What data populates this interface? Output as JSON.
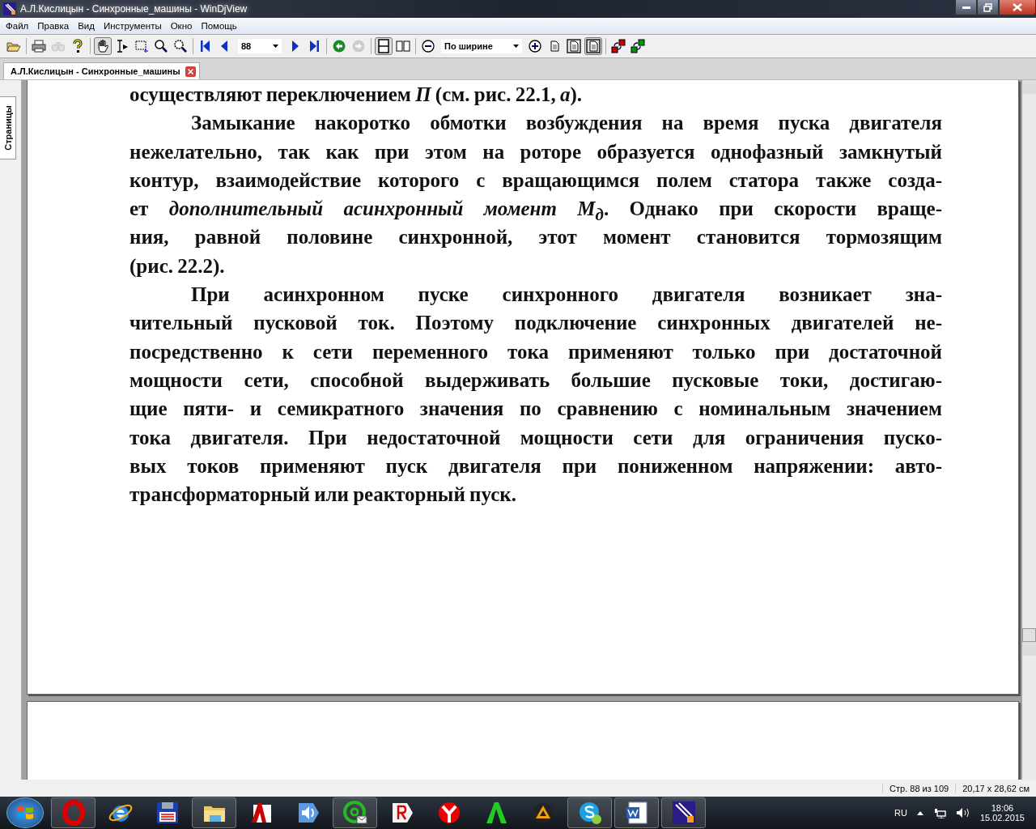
{
  "window": {
    "title": "А.Л.Кислицын - Синхронные_машины - WinDjView"
  },
  "menu": [
    "Файл",
    "Правка",
    "Вид",
    "Инструменты",
    "Окно",
    "Помощь"
  ],
  "toolbar": [
    {
      "kind": "open",
      "selected": false,
      "disabled": false
    },
    {
      "kind": "sep"
    },
    {
      "kind": "print",
      "selected": false,
      "disabled": false
    },
    {
      "kind": "find",
      "selected": false,
      "disabled": true
    },
    {
      "kind": "help",
      "selected": false,
      "disabled": false
    },
    {
      "kind": "sep"
    },
    {
      "kind": "hand",
      "selected": true,
      "disabled": false
    },
    {
      "kind": "text-select",
      "selected": false,
      "disabled": false
    },
    {
      "kind": "rect-select",
      "selected": false,
      "disabled": false
    },
    {
      "kind": "zoom",
      "selected": false,
      "disabled": false
    },
    {
      "kind": "zoom-rect",
      "selected": false,
      "disabled": false
    },
    {
      "kind": "sep"
    },
    {
      "kind": "first",
      "selected": false,
      "disabled": false
    },
    {
      "kind": "prev",
      "selected": false,
      "disabled": false
    },
    {
      "kind": "combo",
      "value": "88"
    },
    {
      "kind": "next",
      "selected": false,
      "disabled": false
    },
    {
      "kind": "last",
      "selected": false,
      "disabled": false
    },
    {
      "kind": "sep"
    },
    {
      "kind": "back",
      "selected": false,
      "disabled": false
    },
    {
      "kind": "forward",
      "selected": false,
      "disabled": true
    },
    {
      "kind": "sep"
    },
    {
      "kind": "single-page",
      "selected": true,
      "disabled": false
    },
    {
      "kind": "two-pages",
      "selected": false,
      "disabled": false
    },
    {
      "kind": "sep"
    },
    {
      "kind": "zoom-out",
      "selected": false,
      "disabled": false
    },
    {
      "kind": "combo",
      "value": "По ширине"
    },
    {
      "kind": "zoom-in",
      "selected": false,
      "disabled": false
    },
    {
      "kind": "page",
      "selected": false,
      "disabled": false
    },
    {
      "kind": "page-frame",
      "selected": false,
      "disabled": false
    },
    {
      "kind": "page-frame",
      "selected": true,
      "disabled": false
    },
    {
      "kind": "sep"
    },
    {
      "kind": "rotate-left",
      "selected": false,
      "disabled": false
    },
    {
      "kind": "rotate-right",
      "selected": false,
      "disabled": false
    }
  ],
  "tabs": [
    {
      "label": "А.Л.Кислицын - Синхронные_машины",
      "selected": true
    }
  ],
  "sidebar": {
    "tab": "Страницы"
  },
  "page": {
    "paragraphs": [
      {
        "indent": false,
        "lines": [
          "осуществляют переключением *П* (см. рис. 22.1, *а*)."
        ]
      },
      {
        "indent": true,
        "lines": [
          "Замыкание накоротко обмотки возбуждения на время пуска двигателя",
          "нежелательно, так как при этом на роторе образуется однофазный замкнутый",
          "контур, взаимодействие которого с вращающимся полем статора также созда-",
          "ет *дополнительный асинхронный момент M$_{д}$*. Однако при скорости враще-",
          "ния, равной половине синхронной, этот момент становится тормозящим",
          "(рис. 22.2)."
        ]
      },
      {
        "indent": true,
        "lines": [
          "При асинхронном пуске синхронного двигателя возникает зна-",
          "чительный пусковой ток. Поэтому подключение синхронных двигателей не-",
          "посредственно к сети переменного тока применяют только при достаточной",
          "мощности сети, способной выдерживать большие пусковые токи, достигаю-",
          "щие пяти- и семикратного значения по сравнению с номинальным значением",
          "тока двигателя. При недостаточной мощности сети для ограничения пуско-",
          "вых токов применяют пуск двигателя при пониженном напряжении: авто-",
          "трансформаторный или реакторный пуск."
        ]
      }
    ]
  },
  "status_bar": {
    "page": "Стр. 88 из 109",
    "size": "20,17 x 28,62 см"
  },
  "taskbar": {
    "apps": [
      {
        "kind": "opera",
        "running": true
      },
      {
        "kind": "ie",
        "running": false
      },
      {
        "kind": "floppy",
        "running": false
      },
      {
        "kind": "explorer",
        "running": true
      },
      {
        "kind": "autocad",
        "running": false
      },
      {
        "kind": "speaker",
        "running": false
      },
      {
        "kind": "qip",
        "running": true
      },
      {
        "kind": "yandex",
        "running": false
      },
      {
        "kind": "yandex-browser",
        "running": false
      },
      {
        "kind": "letter-a",
        "running": false
      },
      {
        "kind": "aimp",
        "running": false
      },
      {
        "kind": "skype",
        "running": true
      },
      {
        "kind": "word",
        "running": true
      },
      {
        "kind": "windjview",
        "running": true
      }
    ],
    "language": "RU",
    "time": "18:06",
    "date": "15.02.2015"
  }
}
